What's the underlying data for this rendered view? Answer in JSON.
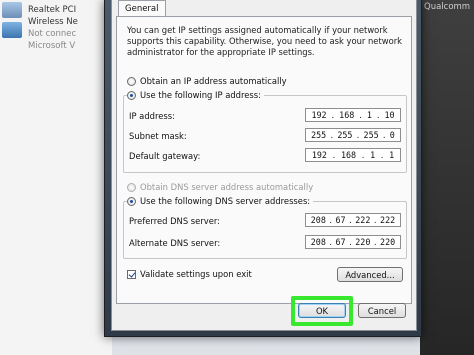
{
  "background": {
    "items": [
      {
        "name": "Realtek PCI",
        "lines": []
      },
      {
        "name": "Wireless Ne",
        "lines": [
          "Not connec",
          "Microsoft V"
        ]
      }
    ],
    "right_label": "Qualcomm"
  },
  "dialog": {
    "tab_label": "General",
    "description": "You can get IP settings assigned automatically if your network supports this capability. Otherwise, you need to ask your network administrator for the appropriate IP settings.",
    "ip_auto_label": "Obtain an IP address automatically",
    "ip_manual_label": "Use the following IP address:",
    "ip_fields": [
      {
        "label": "IP address:",
        "octets": [
          "192",
          "168",
          "1",
          "10"
        ]
      },
      {
        "label": "Subnet mask:",
        "octets": [
          "255",
          "255",
          "255",
          "0"
        ]
      },
      {
        "label": "Default gateway:",
        "octets": [
          "192",
          "168",
          "1",
          "1"
        ]
      }
    ],
    "dns_auto_label": "Obtain DNS server address automatically",
    "dns_manual_label": "Use the following DNS server addresses:",
    "dns_fields": [
      {
        "label": "Preferred DNS server:",
        "octets": [
          "208",
          "67",
          "222",
          "222"
        ]
      },
      {
        "label": "Alternate DNS server:",
        "octets": [
          "208",
          "67",
          "220",
          "220"
        ]
      }
    ],
    "validate_label": "Validate settings upon exit",
    "advanced_label": "Advanced...",
    "ok_label": "OK",
    "cancel_label": "Cancel"
  },
  "colors": {
    "highlight": "#37e82e",
    "selection_dot": "#1b4f9c"
  }
}
